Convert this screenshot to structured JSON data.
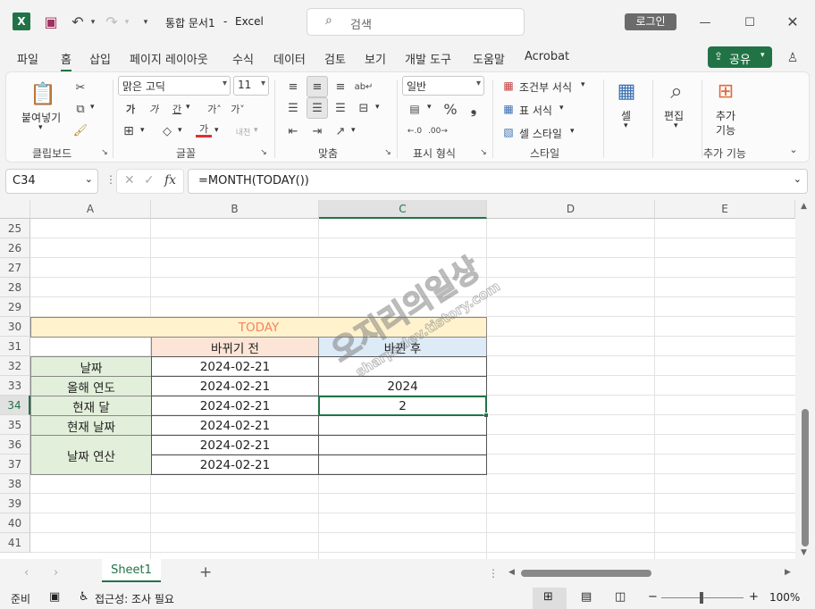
{
  "titlebar": {
    "doc_title": "통합 문서1",
    "app_name": "Excel",
    "search_placeholder": "검색",
    "login_label": "로그인"
  },
  "tabs": [
    "파일",
    "홈",
    "삽입",
    "페이지 레이아웃",
    "수식",
    "데이터",
    "검토",
    "보기",
    "개발 도구",
    "도움말",
    "Acrobat"
  ],
  "active_tab": "홈",
  "share_label": "공유",
  "ribbon": {
    "clipboard": {
      "label": "클립보드",
      "paste": "붙여넣기"
    },
    "font": {
      "label": "글꼴",
      "name": "맑은 고딕",
      "size": "11"
    },
    "alignment": {
      "label": "맞춤"
    },
    "number": {
      "label": "표시 형식",
      "format": "일반"
    },
    "styles": {
      "label": "스타일",
      "conditional": "조건부 서식",
      "table": "표 서식",
      "cell_styles": "셀 스타일"
    },
    "cells": {
      "label": "셀"
    },
    "editing": {
      "label": "편집"
    },
    "addins": {
      "label": "추가 기능",
      "button_line1": "추가",
      "button_line2": "기능"
    }
  },
  "formula_bar": {
    "name_box": "C34",
    "formula": "=MONTH(TODAY())"
  },
  "columns": [
    "A",
    "B",
    "C",
    "D",
    "E"
  ],
  "rows": [
    "25",
    "26",
    "27",
    "28",
    "29",
    "30",
    "31",
    "32",
    "33",
    "34",
    "35",
    "36",
    "37",
    "38",
    "39",
    "40",
    "41"
  ],
  "table": {
    "title": "TODAY",
    "header_before": "바뀌기 전",
    "header_after": "바뀐 후",
    "labels": [
      "날짜",
      "올해 연도",
      "현재 달",
      "현재 날짜",
      "날짜 연산"
    ],
    "before_values": [
      "2024-02-21",
      "2024-02-21",
      "2024-02-21",
      "2024-02-21",
      "2024-02-21",
      "2024-02-21"
    ],
    "after_values": [
      "",
      "2024",
      "2",
      "",
      "",
      ""
    ]
  },
  "watermark": {
    "line1": "오지리의일상",
    "line2": "sharpsdev.tistory.com"
  },
  "sheet_tab": "Sheet1",
  "status": {
    "ready": "준비",
    "accessibility": "접근성: 조사 필요",
    "zoom": "100%"
  },
  "colors": {
    "title_fill": "#fff2cc",
    "title_text": "#f4845f",
    "before_fill": "#fce4d6",
    "after_fill": "#ddebf7",
    "label_fill": "#e2efda",
    "excel_green": "#217346"
  }
}
